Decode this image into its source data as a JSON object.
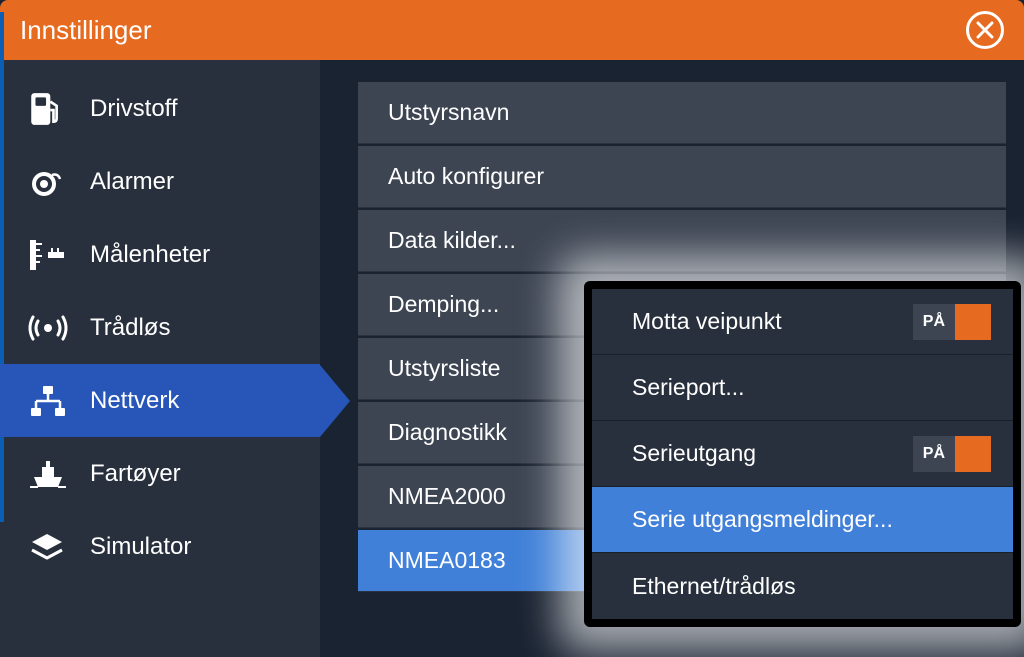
{
  "titleBar": {
    "title": "Innstillinger"
  },
  "sidebar": {
    "items": [
      {
        "label": "Drivstoff"
      },
      {
        "label": "Alarmer"
      },
      {
        "label": "Målenheter"
      },
      {
        "label": "Trådløs"
      },
      {
        "label": "Nettverk"
      },
      {
        "label": "Fartøyer"
      },
      {
        "label": "Simulator"
      }
    ],
    "selectedIndex": 4
  },
  "mainMenu": {
    "items": [
      {
        "label": "Utstyrsnavn"
      },
      {
        "label": "Auto konfigurer"
      },
      {
        "label": "Data kilder..."
      },
      {
        "label": "Demping..."
      },
      {
        "label": "Utstyrsliste"
      },
      {
        "label": "Diagnostikk"
      },
      {
        "label": "NMEA2000"
      },
      {
        "label": "NMEA0183"
      }
    ],
    "selectedIndex": 7
  },
  "popup": {
    "items": [
      {
        "label": "Motta veipunkt",
        "toggle": {
          "state": "PÅ"
        }
      },
      {
        "label": "Serieport..."
      },
      {
        "label": "Serieutgang",
        "toggle": {
          "state": "PÅ"
        }
      },
      {
        "label": "Serie utgangsmeldinger..."
      },
      {
        "label": "Ethernet/trådløs"
      }
    ],
    "selectedIndex": 3
  }
}
